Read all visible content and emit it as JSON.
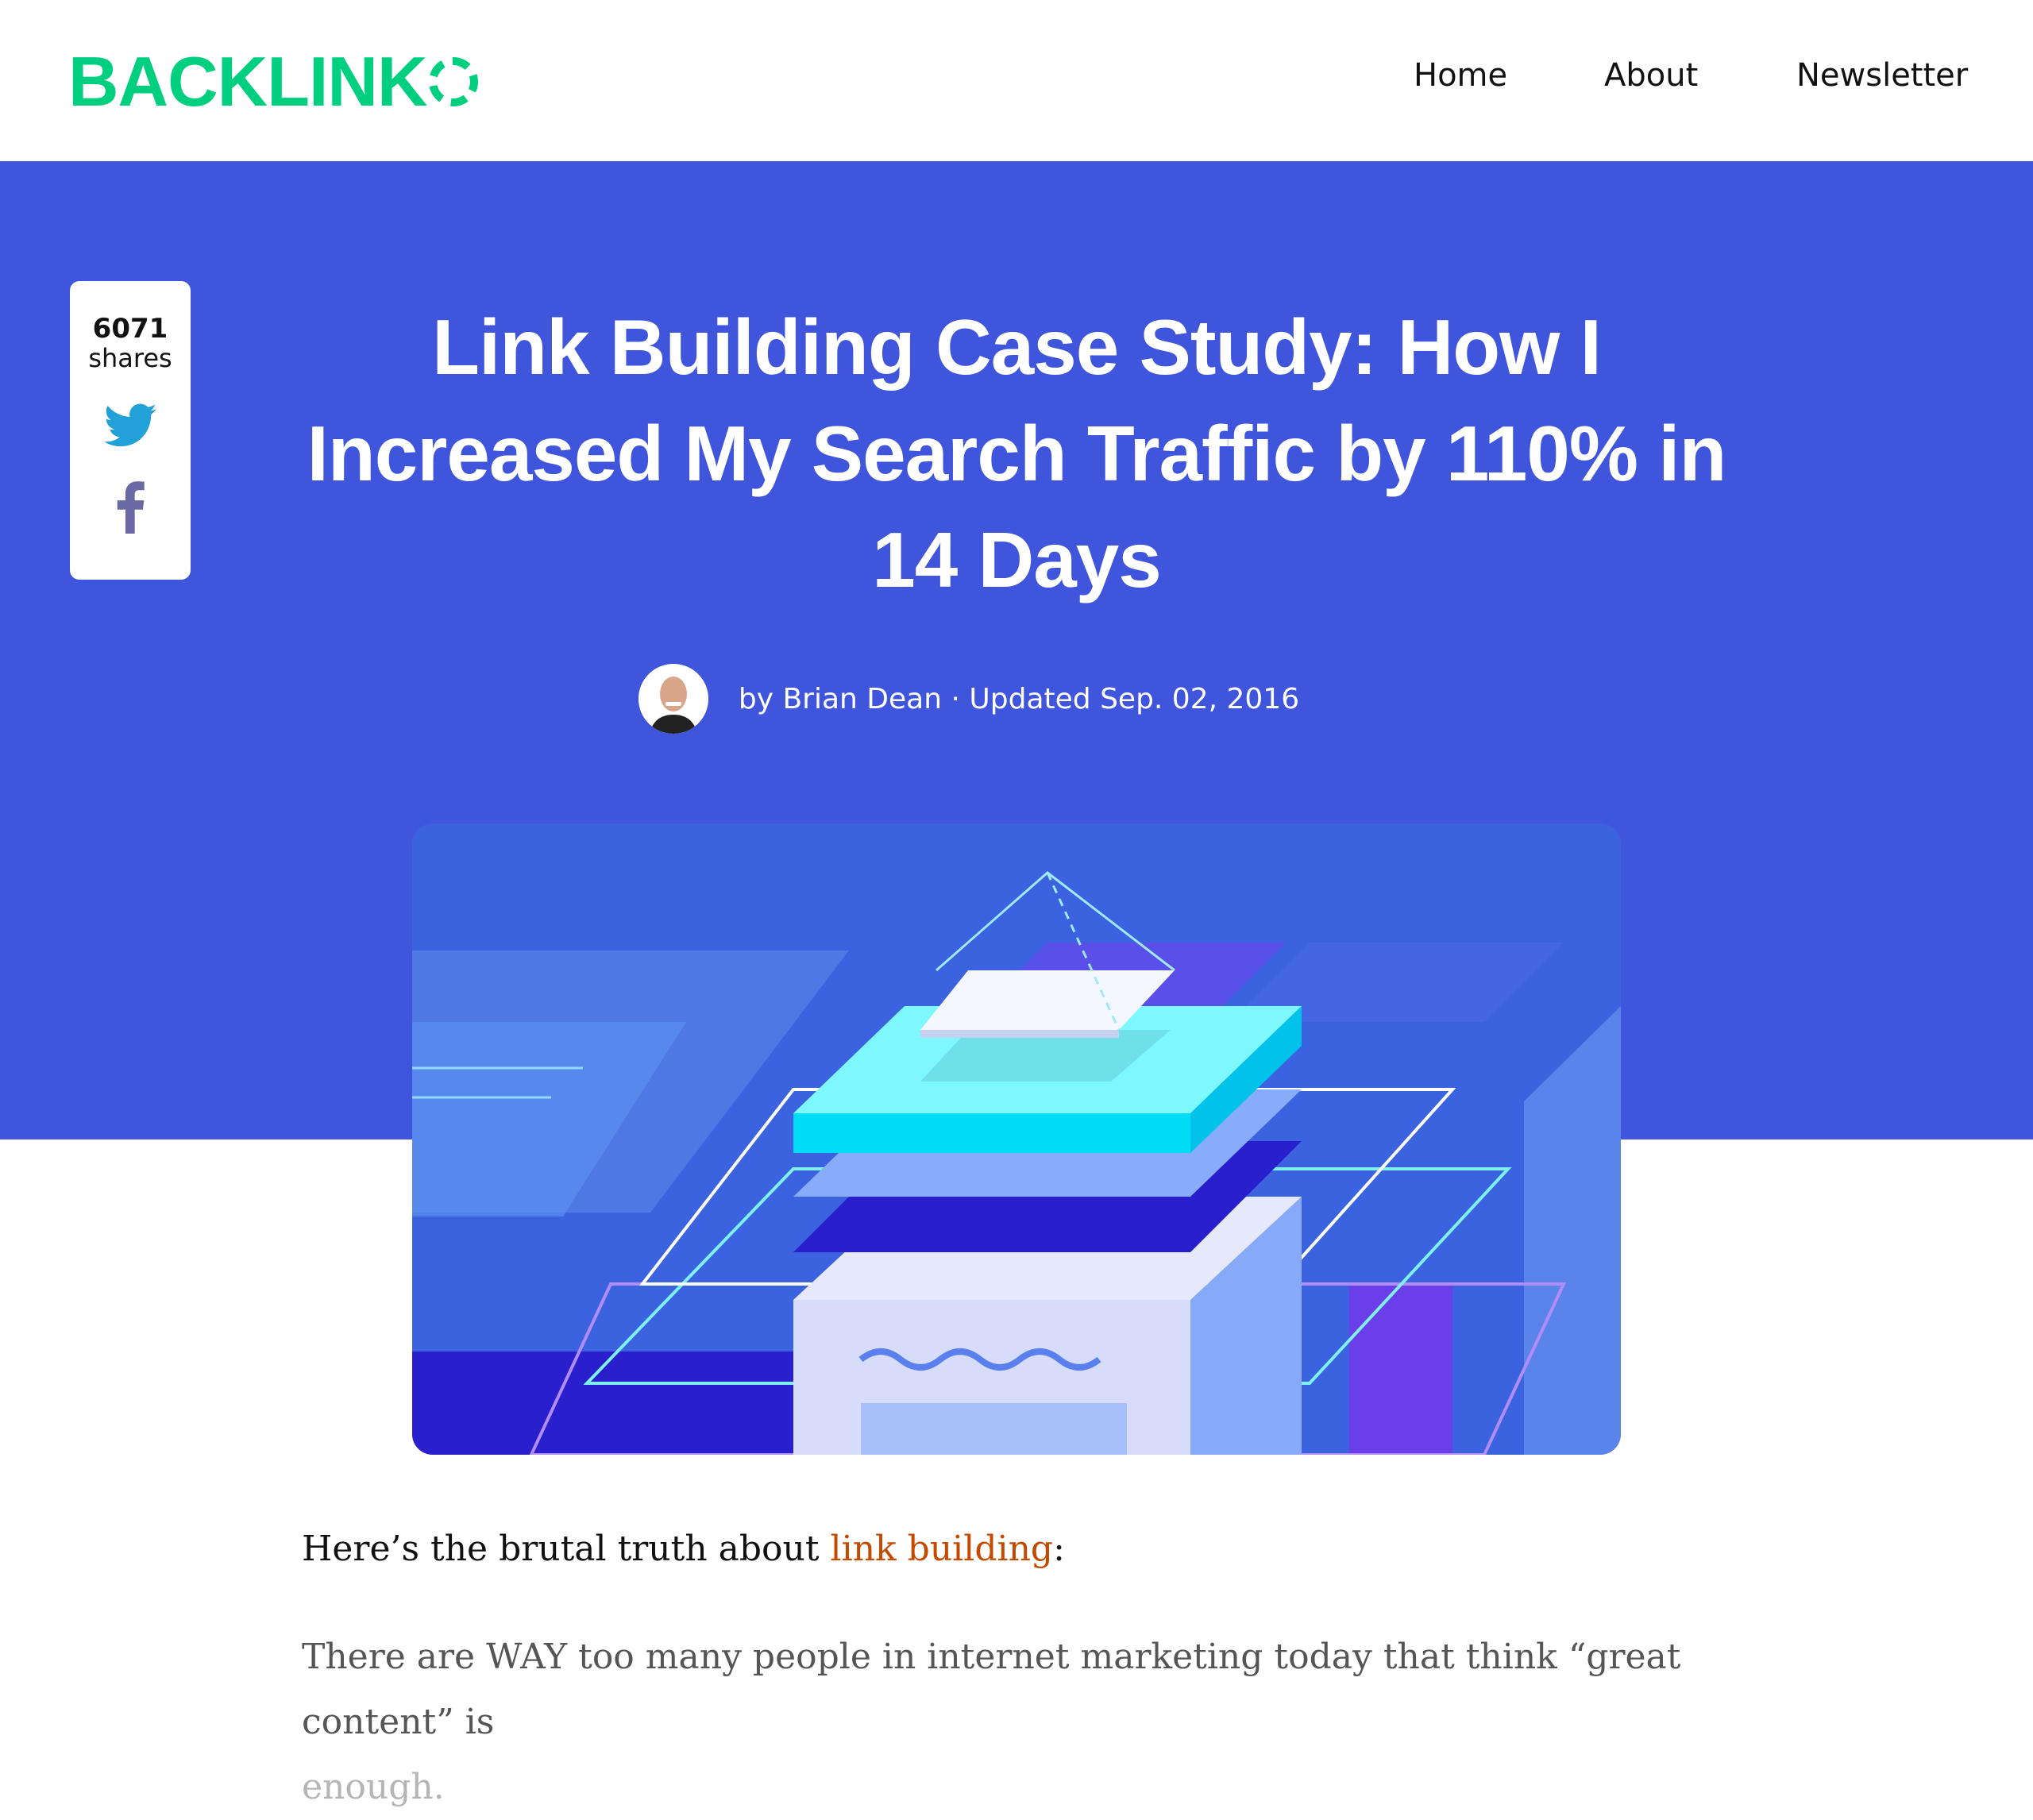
{
  "header": {
    "logo": "BACKLINKO",
    "nav": [
      {
        "label": "Home"
      },
      {
        "label": "About"
      },
      {
        "label": "Newsletter"
      }
    ]
  },
  "share": {
    "count": "6071",
    "label": "shares",
    "icons": [
      "twitter-icon",
      "facebook-icon"
    ]
  },
  "article": {
    "title": "Link Building Case Study: How I Increased My Search Traffic by 110% in 14 Days",
    "author": "by Brian Dean",
    "separator": "·",
    "updated": "Updated Sep. 02, 2016",
    "intro_before": "Here’s the brutal truth about ",
    "intro_link": "link building",
    "intro_after": ":",
    "para2_main": "There are WAY too many people in internet marketing today that think “great content” is",
    "para2_fade": "enough."
  },
  "colors": {
    "brand": "#00cf7f",
    "band": "#3f55dc",
    "link": "#c44a00",
    "twitter": "#22a0d8",
    "facebook": "#6b69a3"
  }
}
